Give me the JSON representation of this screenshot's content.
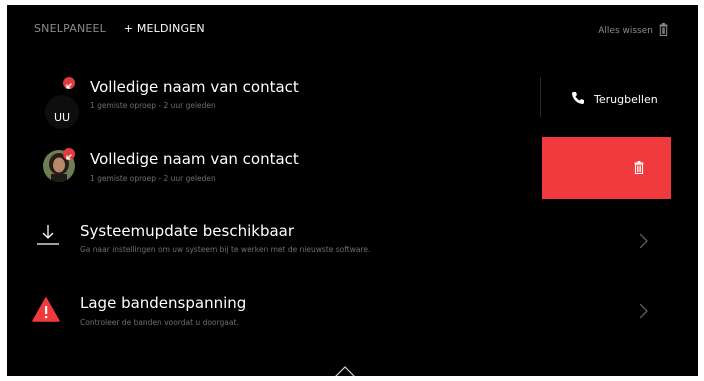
{
  "tabs": {
    "quick_panel": "SNELPANEEL",
    "notifications": "+ MELDINGEN"
  },
  "clear_all": {
    "label": "Alles wissen",
    "icon": "trash-icon"
  },
  "notifications": [
    {
      "type": "missed-call",
      "avatar_initials": "UU",
      "title": "Volledige naam van contact",
      "subtitle": "1 gemiste oproep - 2 uur geleden",
      "action": {
        "label": "Terugbellen",
        "icon": "phone-icon"
      }
    },
    {
      "type": "missed-call",
      "avatar": "photo",
      "title": "Volledige naam van contact",
      "subtitle": "1 gemiste oproep - 2 uur geleden",
      "swipe_action": {
        "icon": "trash-icon",
        "color": "#f13a3d"
      }
    },
    {
      "type": "system",
      "icon": "download-icon",
      "title": "Systeemupdate beschikbaar",
      "subtitle": "Ga naar instellingen om uw systeem bij te werken met de nieuwste software."
    },
    {
      "type": "warning",
      "icon": "warning-icon",
      "title": "Lage bandenspanning",
      "subtitle": "Controleer de banden voordat u doorgaat."
    }
  ],
  "colors": {
    "background": "#000000",
    "accent": "#f13a3d",
    "badge": "#e23b3b",
    "primary_text": "#ffffff",
    "secondary_text": "#6f6f6f"
  }
}
